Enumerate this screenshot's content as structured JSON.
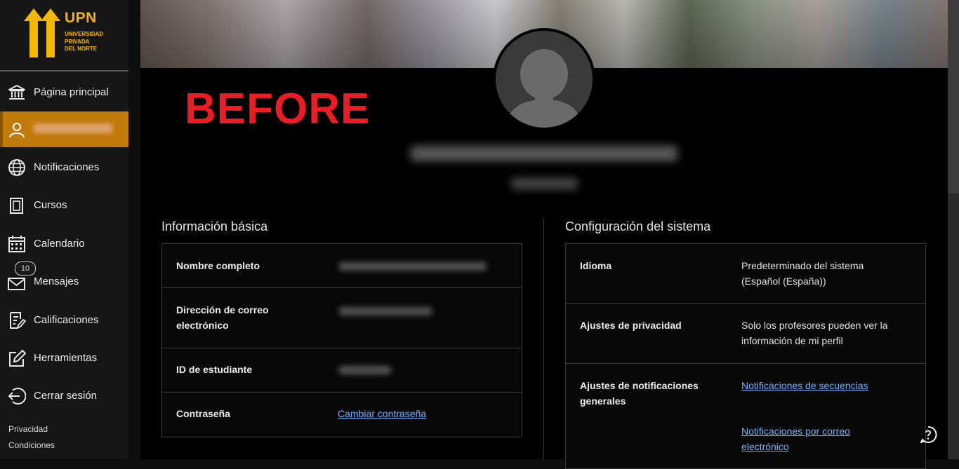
{
  "logo": {
    "brand": "UPN",
    "subtitle_lines": [
      "UNIVERSIDAD",
      "PRIVADA",
      "DEL NORTE"
    ]
  },
  "sidebar": {
    "items": [
      {
        "label": "Página principal",
        "icon": "institution-icon"
      },
      {
        "label": "",
        "icon": "user-icon",
        "active": true
      },
      {
        "label": "Notificaciones",
        "icon": "globe-icon"
      },
      {
        "label": "Cursos",
        "icon": "courses-icon"
      },
      {
        "label": "Calendario",
        "icon": "calendar-icon"
      },
      {
        "label": "Mensajes",
        "icon": "mail-icon",
        "badge": "10"
      },
      {
        "label": "Calificaciones",
        "icon": "grades-icon"
      },
      {
        "label": "Herramientas",
        "icon": "tools-icon"
      },
      {
        "label": "Cerrar sesión",
        "icon": "logout-icon"
      }
    ],
    "footer": {
      "privacy": "Privacidad",
      "terms": "Condiciones"
    }
  },
  "overlay_text": "BEFORE",
  "basic_info": {
    "title": "Información básica",
    "rows": [
      {
        "label": "Nombre completo"
      },
      {
        "label": "Dirección de correo electrónico"
      },
      {
        "label": "ID de estudiante"
      },
      {
        "label": "Contraseña",
        "link": "Cambiar contraseña"
      }
    ]
  },
  "system_config": {
    "title": "Configuración del sistema",
    "rows": [
      {
        "label": "Idioma",
        "value": "Predeterminado del sistema (Español (España))"
      },
      {
        "label": "Ajustes de privacidad",
        "value": "Solo los profesores pueden ver la información de mi perfil"
      },
      {
        "label": "Ajustes de notificaciones generales",
        "links": [
          "Notificaciones de secuencias",
          "Notificaciones por correo electrónico"
        ]
      }
    ]
  },
  "colors": {
    "accent": "#c07a0a",
    "brand": "#f5b800",
    "link": "#6fb2ff",
    "overlay": "#ec1c24"
  },
  "help_icon": "help-icon"
}
